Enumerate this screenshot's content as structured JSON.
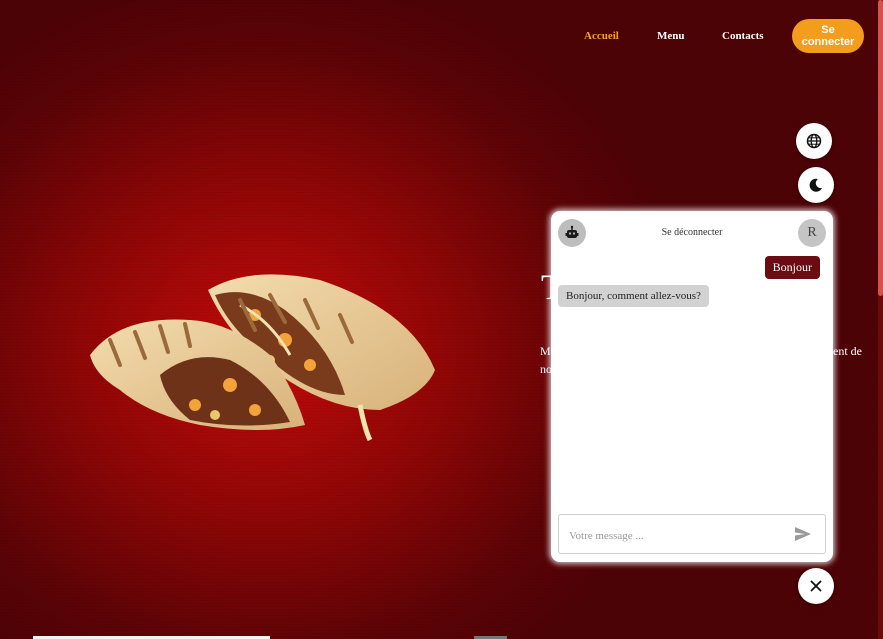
{
  "nav": {
    "items": [
      {
        "label": "Accueil",
        "active": true
      },
      {
        "label": "Menu",
        "active": false
      },
      {
        "label": "Contacts",
        "active": false
      }
    ],
    "login_label": "Se connecter"
  },
  "hero": {
    "title_fragment": "T",
    "text_fragment_1": "M",
    "text_fragment_2": "no",
    "text_fragment_3": "ent de"
  },
  "floating": {
    "language_icon": "globe-icon",
    "theme_icon": "moon-icon",
    "close_icon": "close-icon"
  },
  "chat": {
    "logout_label": "Se déconnecter",
    "user_initial": "R",
    "bot_icon": "robot-icon",
    "messages": [
      {
        "from": "user",
        "text": "Bonjour"
      },
      {
        "from": "bot",
        "text": "Bonjour, comment allez-vous?"
      }
    ],
    "input_placeholder": "Votre message ...",
    "send_icon": "send-icon"
  },
  "colors": {
    "background": "#8e0606",
    "accent": "#f29d1b",
    "user_bubble": "#6b0b12",
    "bot_bubble": "#d2d2d2"
  }
}
